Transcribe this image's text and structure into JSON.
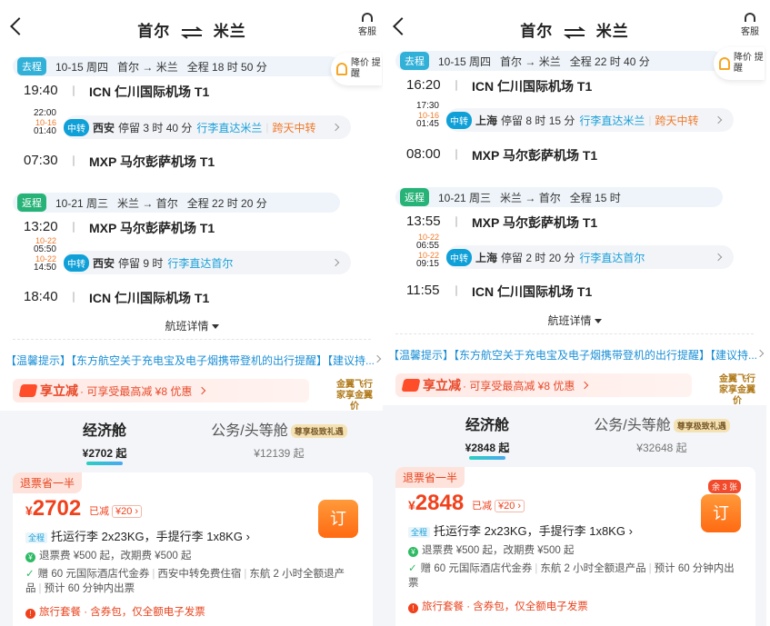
{
  "header": {
    "from": "首尔",
    "to": "米兰",
    "customer_service": "客服"
  },
  "bell_alert": "降价 提醒",
  "panels": [
    {
      "outbound": {
        "tag": "去程",
        "date": "10-15 周四",
        "route": "首尔 → 米兰",
        "duration": "全程 18 时 50 分",
        "dep_time": "19:40",
        "dep_airport": "ICN 仁川国际机场 T1",
        "stop_arr": "22:00",
        "stop_dep_date": "10-16",
        "stop_dep": "01:40",
        "stop_tag": "中转",
        "stop_city": "西安",
        "stop_wait": "停留 3 时 40 分",
        "stop_note1": "行李直达米兰",
        "stop_note2": "跨天中转",
        "arr_time": "07:30",
        "arr_airport": "MXP 马尔彭萨机场 T1"
      },
      "inbound": {
        "tag": "返程",
        "date": "10-21 周三",
        "route": "米兰 → 首尔",
        "duration": "全程 22 时 20 分",
        "dep_time": "13:20",
        "dep_airport": "MXP 马尔彭萨机场 T1",
        "stop_arr_date": "10-22",
        "stop_arr": "05:50",
        "stop_dep_date": "10-22",
        "stop_dep": "14:50",
        "stop_tag": "中转",
        "stop_city": "西安",
        "stop_wait": "停留 9 时",
        "stop_note1": "行李直达首尔",
        "arr_time": "18:40",
        "arr_airport": "ICN 仁川国际机场 T1"
      },
      "details": "航班详情",
      "notice": "【温馨提示】【东方航空关于充电宝及电子烟携带登机的出行提醒】【建议持...",
      "promo": {
        "name": "享立减",
        "desc": "· 可享受最高减 ¥8 优惠",
        "jp": "金翼飞行家享金翼价"
      },
      "cabins": [
        {
          "name": "经济舱",
          "price": "¥2702 起"
        },
        {
          "name": "公务/头等舱",
          "vip": "尊享极致礼遇",
          "price": "¥12139 起"
        }
      ],
      "card": {
        "tag": "退票省一半",
        "price_currency": "¥",
        "price": "2702",
        "discount": "已减",
        "discount_val": "¥20",
        "book": "订",
        "left": "",
        "lug_tag": "全程",
        "luggage": "托运行李 2x23KG，手提行李 1x8KG",
        "refund": "退票费 ¥500 起，改期费 ¥500 起",
        "gift": "赠 60 元国际酒店代金券",
        "gift2": "西安中转免费住宿",
        "gift3": "东航 2 小时全额退产品",
        "gift4": "预计 60 分钟内出票",
        "pkg": "旅行套餐 · 含券包，仅全额电子发票"
      }
    },
    {
      "outbound": {
        "tag": "去程",
        "date": "10-15 周四",
        "route": "首尔 → 米兰",
        "duration": "全程 22 时 40 分",
        "dep_time": "16:20",
        "dep_airport": "ICN 仁川国际机场 T1",
        "stop_arr": "17:30",
        "stop_dep_date": "10-16",
        "stop_dep": "01:45",
        "stop_tag": "中转",
        "stop_city": "上海",
        "stop_wait": "停留 8 时 15 分",
        "stop_note1": "行李直达米兰",
        "stop_note2": "跨天中转",
        "arr_time": "08:00",
        "arr_airport": "MXP 马尔彭萨机场 T1"
      },
      "inbound": {
        "tag": "返程",
        "date": "10-21 周三",
        "route": "米兰 → 首尔",
        "duration": "全程 15 时",
        "dep_time": "13:55",
        "dep_airport": "MXP 马尔彭萨机场 T1",
        "stop_arr_date": "10-22",
        "stop_arr": "06:55",
        "stop_dep_date": "10-22",
        "stop_dep": "09:15",
        "stop_tag": "中转",
        "stop_city": "上海",
        "stop_wait": "停留 2 时 20 分",
        "stop_note1": "行李直达首尔",
        "arr_time": "11:55",
        "arr_airport": "ICN 仁川国际机场 T1"
      },
      "details": "航班详情",
      "notice": "【温馨提示】【东方航空关于充电宝及电子烟携带登机的出行提醒】【建议持...",
      "promo": {
        "name": "享立减",
        "desc": "· 可享受最高减 ¥8 优惠",
        "jp": "金翼飞行家享金翼价"
      },
      "cabins": [
        {
          "name": "经济舱",
          "price": "¥2848 起"
        },
        {
          "name": "公务/头等舱",
          "vip": "尊享极致礼遇",
          "price": "¥32648 起"
        }
      ],
      "card": {
        "tag": "退票省一半",
        "price_currency": "¥",
        "price": "2848",
        "discount": "已减",
        "discount_val": "¥20",
        "book": "订",
        "left": "余 3 张",
        "lug_tag": "全程",
        "luggage": "托运行李 2x23KG，手提行李 1x8KG",
        "refund": "退票费 ¥500 起，改期费 ¥500 起",
        "gift": "赠 60 元国际酒店代金券",
        "gift2": "东航 2 小时全额退产品",
        "gift3": "预计 60 分钟内出票",
        "gift4": "",
        "pkg": "旅行套餐 · 含券包，仅全额电子发票"
      }
    }
  ]
}
